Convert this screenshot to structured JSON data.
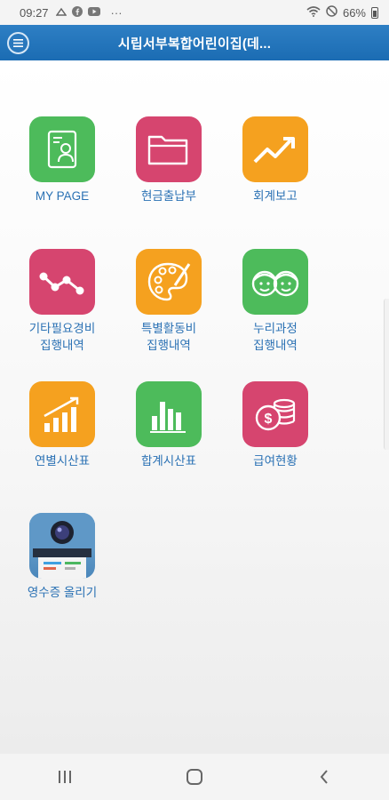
{
  "status_bar": {
    "time": "09:27",
    "dots": "···",
    "battery": "66%",
    "icons": [
      "notification-icon",
      "facebook-icon",
      "youtube-icon",
      "wifi-icon",
      "do-not-disturb-icon",
      "battery-icon"
    ]
  },
  "header": {
    "title": "시립서부복합어린이집(데...",
    "menu_icon": "menu-icon"
  },
  "menu": {
    "items": [
      {
        "label_lines": [
          "MY PAGE"
        ],
        "icon": "profile-card-icon",
        "color": "#4dbb5b"
      },
      {
        "label_lines": [
          "현금출납부"
        ],
        "icon": "folder-icon",
        "color": "#d6456f"
      },
      {
        "label_lines": [
          "회계보고"
        ],
        "icon": "trend-up-icon",
        "color": "#f5a11f"
      },
      {
        "label_lines": [
          "기타필요경비",
          "집행내역"
        ],
        "icon": "line-graph-icon",
        "color": "#d6456f"
      },
      {
        "label_lines": [
          "특별활동비",
          "집행내역"
        ],
        "icon": "palette-icon",
        "color": "#f5a11f"
      },
      {
        "label_lines": [
          "누리과정",
          "집행내역"
        ],
        "icon": "children-faces-icon",
        "color": "#4dbb5b"
      },
      {
        "label_lines": [
          "연별시산표"
        ],
        "icon": "rising-bars-icon",
        "color": "#f5a11f"
      },
      {
        "label_lines": [
          "합계시산표"
        ],
        "icon": "bar-chart-icon",
        "color": "#4dbb5b"
      },
      {
        "label_lines": [
          "급여현황"
        ],
        "icon": "coins-icon",
        "color": "#d6456f"
      },
      {
        "label_lines": [
          "영수증 올리기"
        ],
        "icon": "receipt-scanner-icon",
        "color": "#5f98c7"
      }
    ]
  },
  "nav": {
    "icons": [
      "recent-apps-icon",
      "home-icon",
      "back-icon"
    ]
  }
}
